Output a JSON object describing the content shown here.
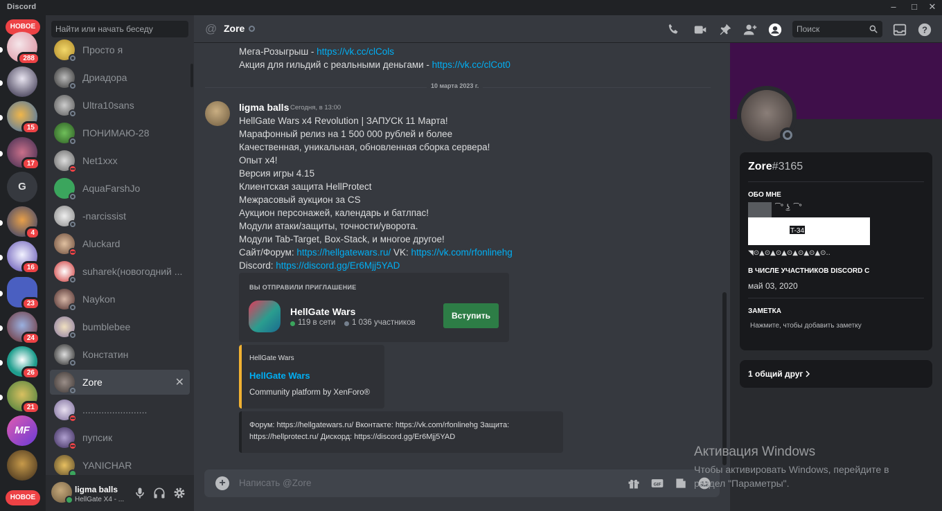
{
  "app": {
    "brand": "Discord"
  },
  "rail": {
    "new_top": "НОВОЕ",
    "new_bottom": "НОВОЕ",
    "servers": [
      {
        "badge": "288"
      },
      {
        "badge": ""
      },
      {
        "badge": "15"
      },
      {
        "badge": "17"
      },
      {
        "letter": "G",
        "badge": ""
      },
      {
        "badge": "4"
      },
      {
        "badge": "16"
      },
      {
        "badge": "23"
      },
      {
        "badge": "24"
      },
      {
        "badge": "26"
      },
      {
        "badge": "21"
      },
      {
        "label": "MF",
        "badge": ""
      },
      {
        "badge": ""
      }
    ]
  },
  "dm_sidebar": {
    "search_placeholder": "Найти или начать беседу",
    "items": [
      {
        "name": "Просто я"
      },
      {
        "name": "Дриадора"
      },
      {
        "name": "Ultra10sans"
      },
      {
        "name": "ПОНИМАЮ-28"
      },
      {
        "name": "Net1xxx"
      },
      {
        "name": "AquaFarshJo"
      },
      {
        "name": "-narcissist"
      },
      {
        "name": "Aluckard"
      },
      {
        "name": "suharek(новогодний ..."
      },
      {
        "name": "Naykon"
      },
      {
        "name": "bumblebee"
      },
      {
        "name": "Констатин"
      },
      {
        "name": "Zore"
      },
      {
        "name": "........................"
      },
      {
        "name": "пупсик"
      },
      {
        "name": "YANICHAR"
      }
    ]
  },
  "user_panel": {
    "name": "ligma balls",
    "status": "HellGate X4 - ..."
  },
  "chat": {
    "header_title": "Zore",
    "search_placeholder": "Поиск",
    "prev_lines": [
      {
        "text": "Мега-Розыгрыш - ",
        "link": "https://vk.cc/clCols"
      },
      {
        "text": "Акция для гильдий с реальными деньгами  - ",
        "link": "https://vk.cc/clCot0"
      }
    ],
    "date_divider": "10 марта 2023 г.",
    "message": {
      "author": "ligma balls",
      "timestamp": "Сегодня, в 13:00",
      "lines": [
        "HellGate Wars x4 Revolution | ЗАПУСК 11 Марта!",
        "Марафонный релиз на 1 500 000 рублей и более",
        "Качественная, уникальная, обновленная сборка сервера!",
        "Опыт x4!",
        "Версия игры 4.15",
        "Клиентская защита HellProtect",
        "Межрасовый аукцион за CS",
        "Аукцион персонажей, календарь и батлпас!",
        "Модули атаки/защиты, точности/уворота.",
        "Модули Tab-Target, Box-Stack, и многое другое!"
      ],
      "site_label": "Сайт/Форум: ",
      "site_link": "https://hellgatewars.ru/",
      "vk_label": " VK: ",
      "vk_link": "https://vk.com/rfonlinehg",
      "discord_label": "Discord: ",
      "discord_link": "https://discord.gg/Er6Mjj5YAD"
    },
    "invite": {
      "caption": "ВЫ ОТПРАВИЛИ ПРИГЛАШЕНИЕ",
      "guild_name": "HellGate Wars",
      "online": "119 в сети",
      "members": "1 036 участников",
      "join_label": "Вступить"
    },
    "embed": {
      "provider": "HellGate Wars",
      "title": "HellGate Wars",
      "description": "Community platform by XenForo®"
    },
    "embed2": {
      "line1": "Форум: https://hellgatewars.ru/ Вконтакте: https://vk.com/rfonlinehg Защита:",
      "line2": "https://hellprotect.ru/ Дискорд: https://discord.gg/Er6Mjj5YAD"
    },
    "composer_placeholder": "Написать @Zore"
  },
  "profile": {
    "username": "Zore",
    "discriminator": "#3165",
    "about_heading": "ОБО МНЕ",
    "about_art_text": "T-34",
    "member_since_heading": "В ЧИСЛЕ УЧАСТНИКОВ DISCORD С",
    "member_since": "май 03, 2020",
    "note_heading": "ЗАМЕТКА",
    "note_placeholder": "Нажмите, чтобы добавить заметку",
    "mutual_friends": "1 общий друг"
  },
  "watermark": {
    "title": "Активация Windows",
    "line1": "Чтобы активировать Windows, перейдите в",
    "line2": "раздел \"Параметры\"."
  },
  "colors": {
    "accent_link": "#00aff4",
    "join_button": "#2d7d46",
    "badge_red": "#ed4245",
    "banner": "#3f0f4a",
    "embed_border": "#f0b132"
  }
}
